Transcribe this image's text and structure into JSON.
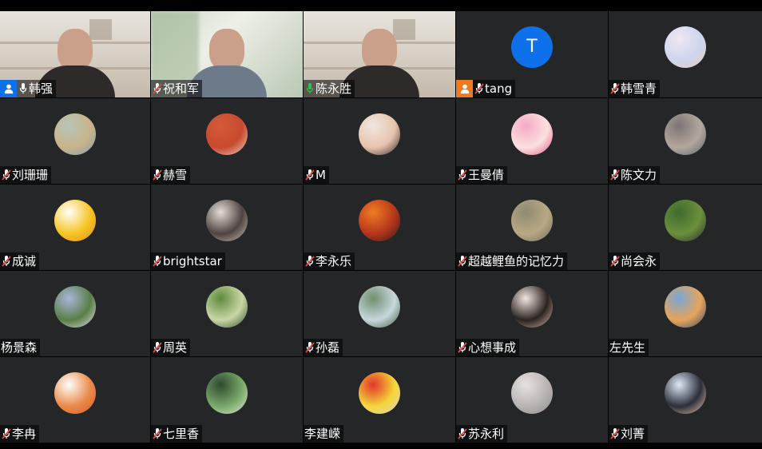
{
  "participants": [
    {
      "name": "韩强",
      "mic": "on",
      "host_badge": "blue",
      "avatar": "video",
      "scene": "shelf"
    },
    {
      "name": "祝和军",
      "mic": "muted",
      "host_badge": null,
      "avatar": "video",
      "scene": "window"
    },
    {
      "name": "陈永胜",
      "mic": "active",
      "host_badge": null,
      "avatar": "video",
      "scene": "shelf",
      "speaking": true
    },
    {
      "name": "tang",
      "mic": "muted",
      "host_badge": "orange",
      "avatar": "letter",
      "letter": "T"
    },
    {
      "name": "韩雪青",
      "mic": "muted",
      "host_badge": null,
      "avatar": "photo",
      "colors": [
        "#f1e7f2",
        "#cdd6ee",
        "#e8c9b3"
      ]
    },
    {
      "name": "刘珊珊",
      "mic": "muted",
      "host_badge": null,
      "avatar": "photo",
      "colors": [
        "#b7c4b8",
        "#c9b48a",
        "#7f9db2"
      ]
    },
    {
      "name": "赫雪",
      "mic": "muted",
      "host_badge": null,
      "avatar": "photo",
      "colors": [
        "#d45a3a",
        "#c84a2f",
        "#e8d5c0"
      ]
    },
    {
      "name": "M",
      "mic": "muted",
      "host_badge": null,
      "avatar": "photo",
      "colors": [
        "#f1e7df",
        "#e8c3ad",
        "#2a2524"
      ]
    },
    {
      "name": "王曼倩",
      "mic": "muted",
      "host_badge": null,
      "avatar": "photo",
      "colors": [
        "#f6a9c6",
        "#fbe1df",
        "#e6547f"
      ]
    },
    {
      "name": "陈文力",
      "mic": "muted",
      "host_badge": null,
      "avatar": "photo",
      "colors": [
        "#7a7573",
        "#b3a89d",
        "#58616e"
      ]
    },
    {
      "name": "成诚",
      "mic": "muted",
      "host_badge": null,
      "avatar": "photo",
      "colors": [
        "#ffffff",
        "#f6c523",
        "#e38d1f"
      ]
    },
    {
      "name": "brightstar",
      "mic": "muted",
      "host_badge": null,
      "avatar": "photo",
      "colors": [
        "#e5ddd4",
        "#4d4442",
        "#cfc2b6"
      ]
    },
    {
      "name": "李永乐",
      "mic": "muted",
      "host_badge": null,
      "avatar": "photo",
      "colors": [
        "#f07c22",
        "#b5361c",
        "#2a1d1c"
      ]
    },
    {
      "name": "超越鲤鱼的记忆力",
      "mic": "muted",
      "host_badge": null,
      "avatar": "photo",
      "colors": [
        "#8f8a6f",
        "#b9a886",
        "#6d6d5b"
      ]
    },
    {
      "name": "尚会永",
      "mic": "muted",
      "host_badge": null,
      "avatar": "photo",
      "colors": [
        "#3f6a2f",
        "#6b8f3c",
        "#2c2c2c"
      ]
    },
    {
      "name": "杨景森",
      "mic": "none",
      "host_badge": null,
      "avatar": "photo",
      "colors": [
        "#a9b6dd",
        "#5a7e46",
        "#e3e5f0"
      ]
    },
    {
      "name": "周英",
      "mic": "muted",
      "host_badge": null,
      "avatar": "photo",
      "colors": [
        "#5f8b3b",
        "#c9d6a7",
        "#2f4d23"
      ]
    },
    {
      "name": "孙磊",
      "mic": "muted",
      "host_badge": null,
      "avatar": "photo",
      "colors": [
        "#6f8f6d",
        "#c8d6dd",
        "#3e5d3a"
      ]
    },
    {
      "name": "心想事成",
      "mic": "muted",
      "host_badge": null,
      "avatar": "photo",
      "colors": [
        "#f3e6df",
        "#2a2320",
        "#d8b7a5"
      ]
    },
    {
      "name": "左先生",
      "mic": "none",
      "host_badge": null,
      "avatar": "photo",
      "colors": [
        "#78a6d6",
        "#e8a45a",
        "#2f4a6e"
      ]
    },
    {
      "name": "李冉",
      "mic": "muted",
      "host_badge": null,
      "avatar": "photo",
      "colors": [
        "#ffffff",
        "#e98a4a",
        "#d85b2a"
      ]
    },
    {
      "name": "七里香",
      "mic": "muted",
      "host_badge": null,
      "avatar": "photo",
      "colors": [
        "#2e4a2e",
        "#7aa86a",
        "#dfe7d7"
      ]
    },
    {
      "name": "李建嵘",
      "mic": "none",
      "host_badge": null,
      "avatar": "photo",
      "colors": [
        "#e2352a",
        "#f4d83a",
        "#d8d4cf"
      ]
    },
    {
      "name": "苏永利",
      "mic": "muted",
      "host_badge": null,
      "avatar": "photo",
      "colors": [
        "#e7e2e1",
        "#b9b3b3",
        "#8f8a8b"
      ]
    },
    {
      "name": "刘菁",
      "mic": "muted",
      "host_badge": null,
      "avatar": "photo",
      "colors": [
        "#dfe9f6",
        "#2a2f3a",
        "#f0c7a9"
      ]
    }
  ],
  "ui_colors": {
    "tile_bg": "#242628",
    "speaking_border": "#2fbf4f",
    "muted_mic": "#e04b4b",
    "active_mic": "#2fbf4f",
    "host_badge_blue": "#0e71eb",
    "host_badge_orange": "#f0791e"
  },
  "icons": {
    "mic_on": "microphone-icon",
    "mic_muted": "microphone-muted-icon",
    "host": "person-icon"
  }
}
